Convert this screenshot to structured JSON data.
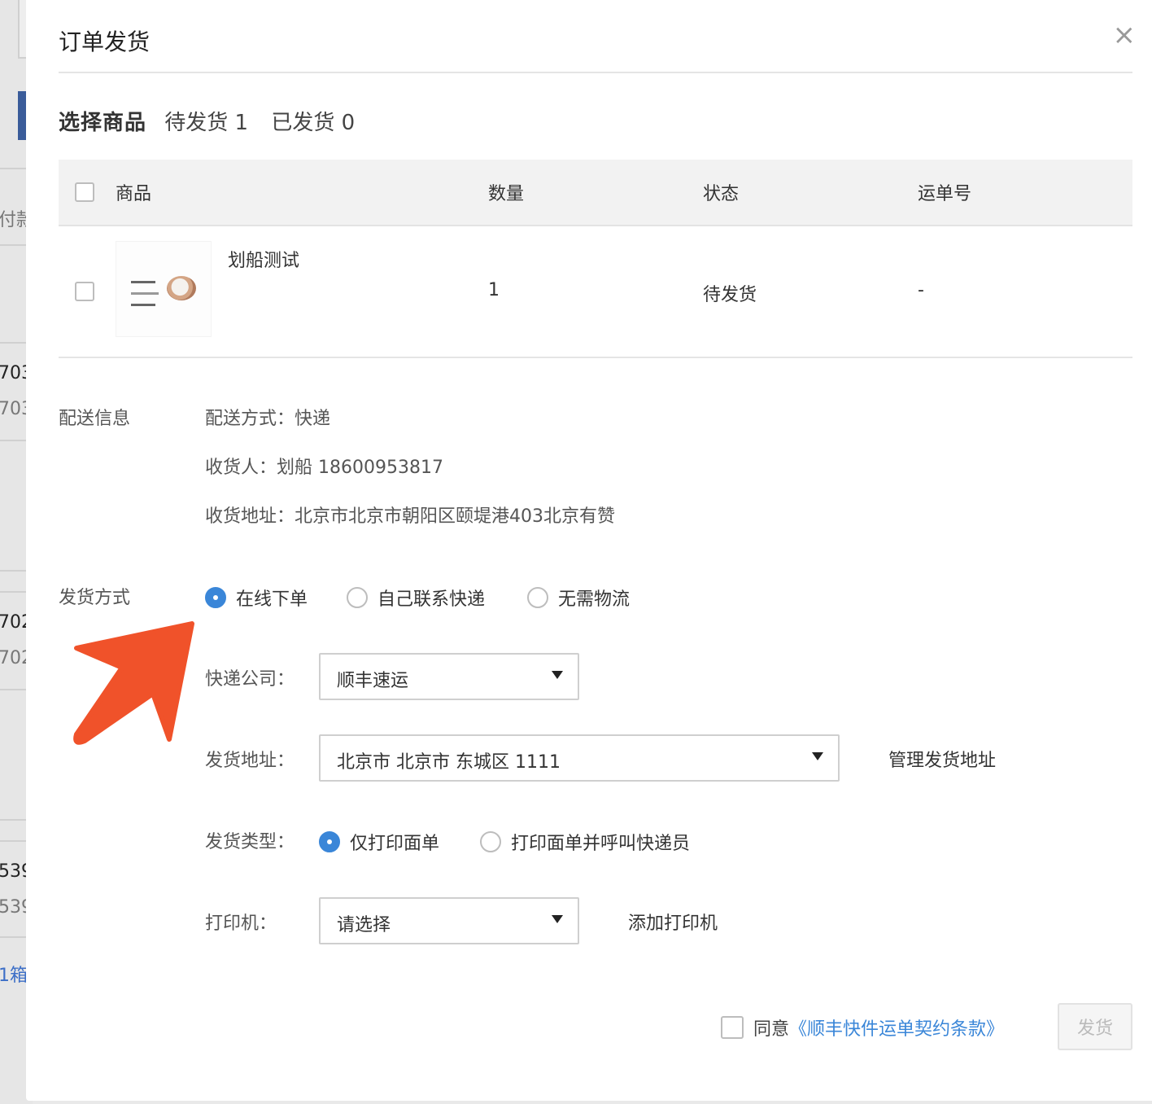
{
  "background": {
    "fragments": [
      "付款",
      "703",
      "703",
      "702",
      "702",
      "539",
      "539",
      "1箱"
    ]
  },
  "dialog": {
    "title": "订单发货",
    "close_glyph": "×"
  },
  "select_goods": {
    "heading": "选择商品",
    "pending_label": "待发货 1",
    "shipped_label": "已发货 0"
  },
  "table": {
    "headers": [
      "商品",
      "数量",
      "状态",
      "运单号"
    ],
    "rows": [
      {
        "name": "划船测试",
        "quantity": "1",
        "status": "待发货",
        "tracking": "-"
      }
    ]
  },
  "delivery": {
    "label": "配送信息",
    "method": "配送方式：快递",
    "receiver": "收货人：划船 18600953817",
    "address": "收货地址：北京市北京市朝阳区颐堤港403北京有赞"
  },
  "ship_method": {
    "label": "发货方式",
    "options": [
      "在线下单",
      "自己联系快递",
      "无需物流"
    ],
    "selected": "在线下单"
  },
  "form": {
    "courier_label": "快递公司：",
    "courier_value": "顺丰速运",
    "address_label": "发货地址：",
    "address_value": "北京市 北京市 东城区 1111",
    "manage_address_link": "管理发货地址",
    "type_label": "发货类型：",
    "type_options": [
      "仅打印面单",
      "打印面单并呼叫快递员"
    ],
    "type_selected": "仅打印面单",
    "printer_label": "打印机：",
    "printer_value": "请选择",
    "add_printer_link": "添加打印机"
  },
  "footer": {
    "agree_prefix": "同意",
    "agree_link": "《顺丰快件运单契约条款》",
    "ship_button": "发货"
  },
  "colors": {
    "link": "#3a86d8",
    "radio_on": "#3a86d8",
    "arrow": "#f0522a"
  }
}
